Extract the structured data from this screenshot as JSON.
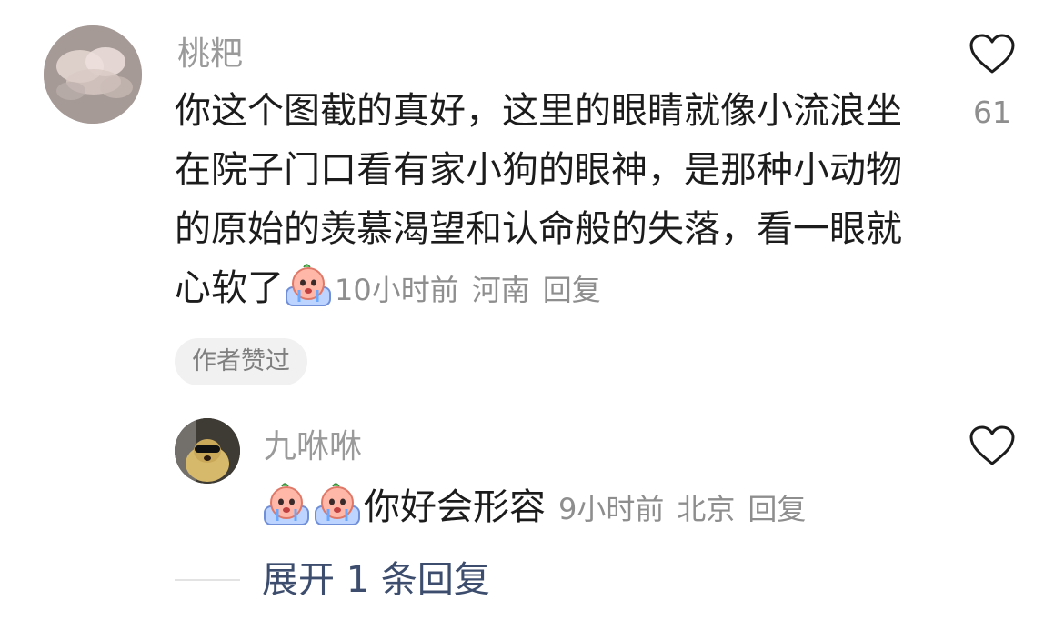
{
  "comment": {
    "username": "桃粑",
    "text_part": "你这个图截的真好，这里的眼睛就像小流浪坐在院子门口看有家小狗的眼神，是那种小动物的原始的羡慕渴望和认命般的失落，看一眼就心软了",
    "emoji_icon": "crying-face-emoji",
    "time": "10小时前",
    "location": "河南",
    "reply_label": "回复",
    "like_count": "61",
    "badge": "作者赞过"
  },
  "reply": {
    "username": "九咻咻",
    "emoji_icon": "crying-face-emoji",
    "emoji_count": 2,
    "text": "你好会形容",
    "time": "9小时前",
    "location": "北京",
    "reply_label": "回复"
  },
  "expand_label": "展开 1 条回复",
  "colors": {
    "username": "#9a9a9a",
    "body_text": "#1c1c1c",
    "meta": "#8e8e8e",
    "badge_bg": "#f1f1f1",
    "link": "#3d4d6e"
  }
}
